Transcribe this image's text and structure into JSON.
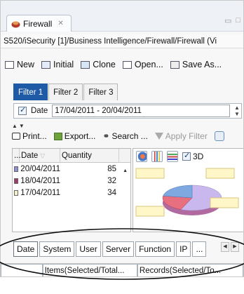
{
  "window": {
    "tab_title": "Firewall",
    "tab_close": "✕",
    "path": "S520/iSecurity [1]/Business Intelligence/Firewall/Firewall (Vi"
  },
  "toolbar": {
    "new_label": "New",
    "initial_label": "Initial",
    "clone_label": "Clone",
    "open_label": "Open...",
    "save_as_label": "Save As..."
  },
  "filter_tabs": [
    "Filter 1",
    "Filter 2",
    "Filter 3"
  ],
  "date_filter": {
    "label": "Date",
    "value": "17/04/2011 - 20/04/2011",
    "checked": true
  },
  "actions": {
    "print_label": "Print...",
    "export_label": "Export...",
    "search_label": "Search ...",
    "apply_filter_label": "Apply Filter"
  },
  "table": {
    "col_prefix": "...",
    "col_date": "Date",
    "col_quantity": "Quantity",
    "rows": [
      {
        "date": "20/04/2011",
        "quantity": "85",
        "color": "#8f8fd6"
      },
      {
        "date": "18/04/2011",
        "quantity": "32",
        "color": "#a13a6b"
      },
      {
        "date": "17/04/2011",
        "quantity": "34",
        "color": "#f5f0c8"
      }
    ]
  },
  "chart_tools": {
    "three_d_label": "3D"
  },
  "chart_data": {
    "type": "pie",
    "categories": [
      "20/04/2011",
      "18/04/2011",
      "17/04/2011"
    ],
    "values": [
      85,
      32,
      34
    ],
    "colors": [
      "#c9b8ee",
      "#e6707f",
      "#7fa8e0"
    ],
    "three_d": true
  },
  "bottom_tabs": [
    "Date",
    "System",
    "User",
    "Server",
    "Function",
    "IP",
    "..."
  ],
  "status": {
    "items": "Items(Selected/Total...",
    "records": "Records(Selected/To..."
  }
}
